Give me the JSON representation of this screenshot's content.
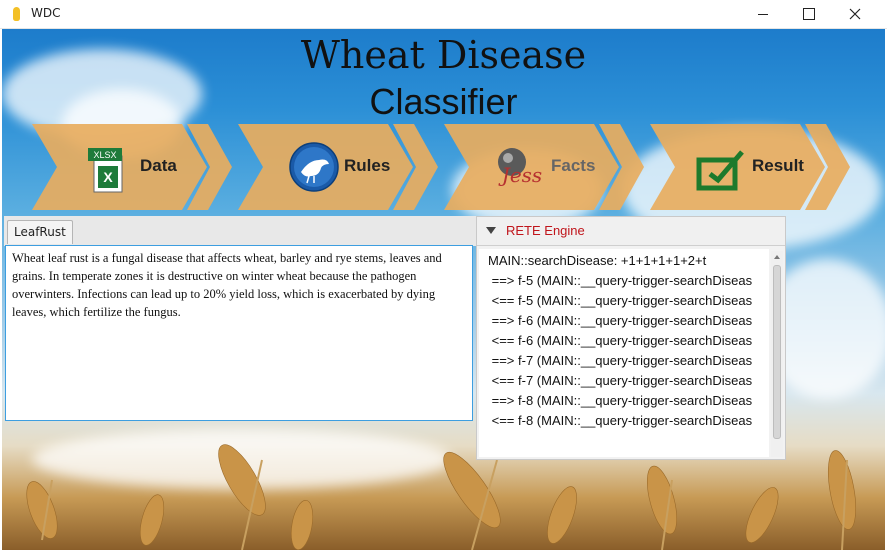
{
  "window": {
    "title": "WDC",
    "minimize_icon": "minimize-icon",
    "maximize_icon": "maximize-icon",
    "close_icon": "close-icon"
  },
  "app": {
    "title_line1": "Wheat Disease",
    "title_line2": "Classifier"
  },
  "steps": [
    {
      "label": "Data",
      "icon": "excel-file-icon",
      "icon_text": "XLSX",
      "active": true
    },
    {
      "label": "Rules",
      "icon": "bird-globe-icon",
      "active": true
    },
    {
      "label": "Facts",
      "icon": "jess-logo-icon",
      "icon_text": "Jess",
      "active": false
    },
    {
      "label": "Result",
      "icon": "result-checkbox-icon",
      "active": true
    }
  ],
  "left_panel": {
    "tab_label": "LeafRust",
    "text": "Wheat leaf rust is a fungal disease that affects wheat, barley and rye stems, leaves and grains. In temperate zones it is destructive on winter wheat because the pathogen overwinters. Infections can lead up to 20% yield loss, which is exacerbated by dying leaves, which fertilize the fungus."
  },
  "rete_panel": {
    "title": "RETE Engine",
    "lines": [
      "MAIN::searchDisease: +1+1+1+1+2+t",
      " ==> f-5 (MAIN::__query-trigger-searchDiseas",
      " <== f-5 (MAIN::__query-trigger-searchDiseas",
      " ==> f-6 (MAIN::__query-trigger-searchDiseas",
      " <== f-6 (MAIN::__query-trigger-searchDiseas",
      " ==> f-7 (MAIN::__query-trigger-searchDiseas",
      " <== f-7 (MAIN::__query-trigger-searchDiseas",
      " ==> f-8 (MAIN::__query-trigger-searchDiseas",
      " <== f-8 (MAIN::__query-trigger-searchDiseas"
    ]
  },
  "colors": {
    "arrow_fill": "#e8ac5e",
    "rete_title": "#c0151b",
    "text_border": "#3d9ee0"
  }
}
